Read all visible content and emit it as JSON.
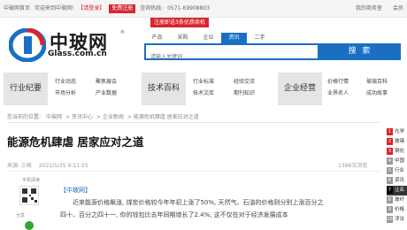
{
  "topbar": {
    "home": "中玻网首页",
    "welcome": "欢迎来到中玻网!",
    "login": "【请登录】",
    "register": "免费注册",
    "hotline_label": "咨询热线:",
    "hotline": "0571-69908803",
    "my_business": "我的商务室",
    "member": "会员"
  },
  "logo": {
    "cn": "中玻网",
    "en": "Glass.com.cn",
    "reg": "®"
  },
  "promo": "注册即送3条优质商机",
  "search": {
    "tabs": [
      "产品",
      "采购",
      "企业",
      "资讯",
      "二手"
    ],
    "active_tab": "资讯",
    "placeholder": "请输入关键词",
    "button": "搜 索"
  },
  "nav": {
    "groups": [
      {
        "title": "行业纪要",
        "links": [
          "行业动态",
          "市场分析",
          "聚焦展会",
          "产业数据"
        ]
      },
      {
        "title": "技术百科",
        "links": [
          "行业标准",
          "技术文库",
          "经验交流",
          "期刊知识"
        ]
      },
      {
        "title": "企业经营",
        "links": [
          "价格行情",
          "业界名人",
          "玻璃百科",
          "成功故事"
        ]
      }
    ]
  },
  "breadcrumb": {
    "prefix": "您当前的位置:",
    "items": [
      "中玻网",
      "资讯中心",
      "企业新闻",
      "能源危机肆虐 居家应对之道"
    ]
  },
  "article": {
    "title": "能源危机肆虐 居家应对之道",
    "source": "来源: 三峡",
    "date": "2022/5/25 9:11:55",
    "views": "1396次浏览",
    "mobile_read": "手机阅读",
    "share": "分享",
    "source_tag": "【中玻网】",
    "lines": [
      "近来能源价格飙涨, 煤炭价格较今年年初上涨了50%, 天然气、石油的价格则分别上涨百分之",
      "四十、百分之四十一, 你的钱",
      "包比去年同期增长了2.4%, 这不仅在对于经济发展成本"
    ]
  },
  "ranking": {
    "items": [
      {
        "no": "1",
        "text": "光学"
      },
      {
        "no": "2",
        "text": "玻璃"
      },
      {
        "no": "3",
        "text": "钢化"
      },
      {
        "no": "4",
        "text": "中国"
      },
      {
        "no": "5",
        "text": "行业"
      },
      {
        "no": "6",
        "text": "资讯"
      },
      {
        "no": "7",
        "text": "让名"
      },
      {
        "no": "8",
        "text": "玻纤"
      },
      {
        "no": "9",
        "text": "价格"
      },
      {
        "no": "10",
        "text": "浮法"
      }
    ]
  },
  "colors": {
    "brand_blue": "#1a6fc2",
    "accent_red": "#d9252d"
  }
}
